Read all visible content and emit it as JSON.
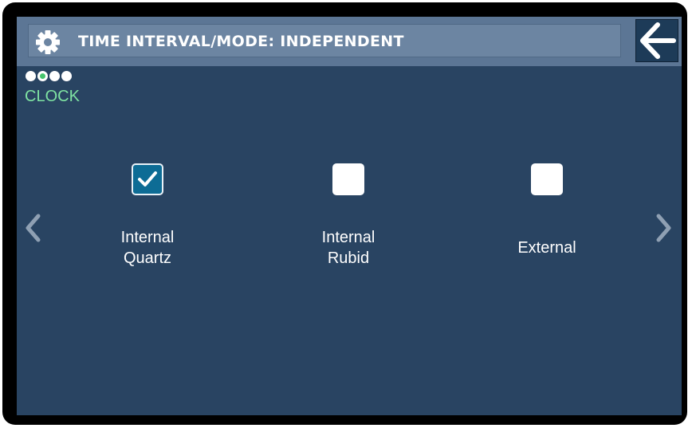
{
  "header": {
    "title": "TIME INTERVAL/MODE: INDEPENDENT",
    "settings_icon": "gear-icon",
    "back_icon": "arrow-left-icon"
  },
  "page_indicator": {
    "count": 4,
    "active_index": 1
  },
  "mode_label": "CLOCK",
  "options": [
    {
      "label": "Internal\nQuartz",
      "checked": true
    },
    {
      "label": "Internal\nRubid",
      "checked": false
    },
    {
      "label": "External",
      "checked": false
    }
  ],
  "colors": {
    "screen_bg": "#294462",
    "header_bg": "#5c7695",
    "accent_green": "#7fe3a2",
    "checked_fill": "#0d6c95"
  }
}
